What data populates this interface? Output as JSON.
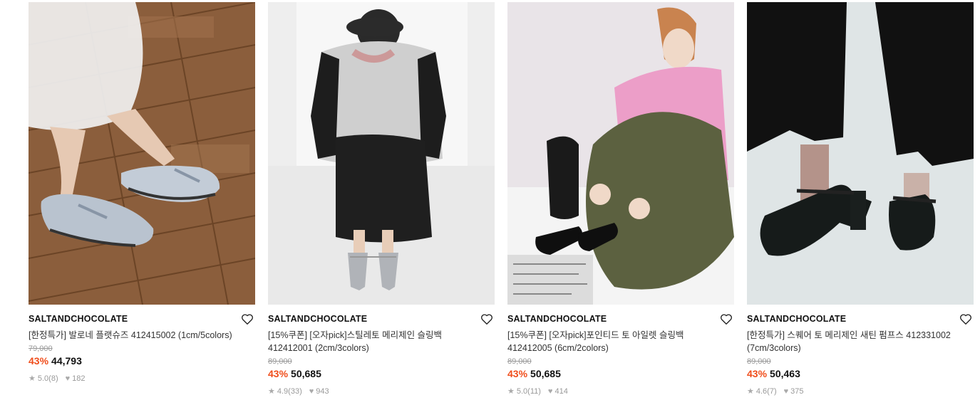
{
  "products": [
    {
      "brand": "SALTANDCHOCOLATE",
      "name": "[한정특가] 발로네 플랫슈즈 412415002 (1cm/5colors)",
      "original_price": "79,000",
      "discount": "43%",
      "price": "44,793",
      "rating": "5.0",
      "reviews": "(8)",
      "likes": "182",
      "image": "model in white tulle skirt wearing silver mary-jane flats on wooden herringbone floor"
    },
    {
      "brand": "SALTANDCHOCOLATE",
      "name": "[15%쿠폰] [오자pick]스틸레토 메리제인 슬링백 412412001 (2cm/3colors)",
      "original_price": "89,000",
      "discount": "43%",
      "price": "50,685",
      "rating": "4.9",
      "reviews": "(33)",
      "likes": "943",
      "image": "model in grey zip jacket and black skirt sitting, wearing silver pointed slingbacks"
    },
    {
      "brand": "SALTANDCHOCOLATE",
      "name": "[15%쿠폰] [오자pick]포인티드 토 아일렛 슬링백 412412005 (6cm/2colors)",
      "original_price": "89,000",
      "discount": "43%",
      "price": "50,685",
      "rating": "5.0",
      "reviews": "(11)",
      "likes": "414",
      "image": "model in pink shirt and olive skirt sitting with black patent slingbacks and newspaper"
    },
    {
      "brand": "SALTANDCHOCOLATE",
      "name": "[한정특가] 스퀘어 토 메리제인 새틴 펌프스 412331002 (7cm/3colors)",
      "original_price": "89,000",
      "discount": "43%",
      "price": "50,463",
      "rating": "4.6",
      "reviews": "(7)",
      "likes": "375",
      "image": "legs in black wide trousers wearing black satin square-toe mary-jane pumps"
    }
  ],
  "colors": {
    "discount": "#f04e1c",
    "muted": "#999999"
  },
  "icons": {
    "wishlist": "heart-outline-icon",
    "rating": "star-icon",
    "likes": "heart-filled-icon"
  }
}
